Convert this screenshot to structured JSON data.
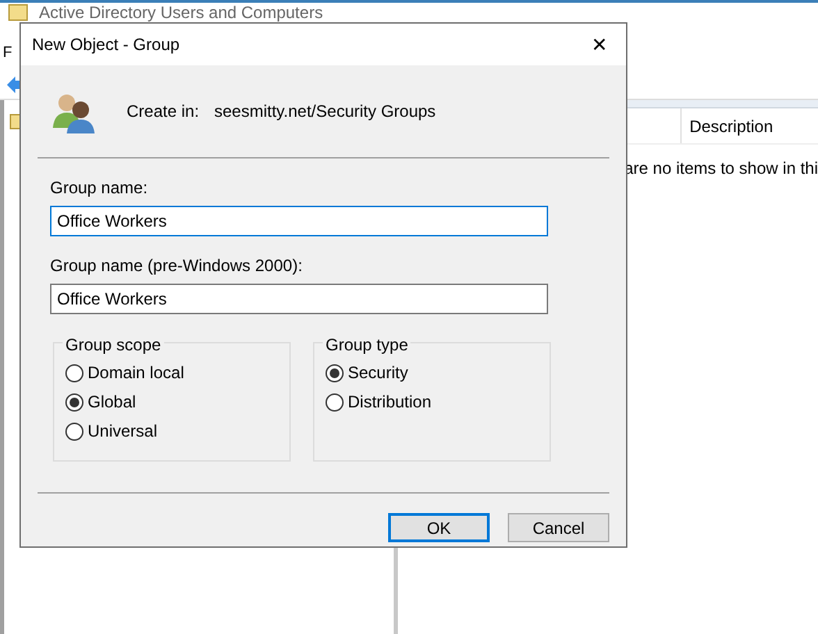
{
  "background_window": {
    "title": "Active Directory Users and Computers",
    "menu_letter": "F",
    "column_header": "Description",
    "empty_message": "are no items to show in thi"
  },
  "dialog": {
    "title": "New Object - Group",
    "close": "✕",
    "create_in_label": "Create in:",
    "create_in_path": "seesmitty.net/Security Groups",
    "fields": [
      {
        "label": "Group name:",
        "value": "Office Workers",
        "focused": true
      },
      {
        "label": "Group name (pre-Windows 2000):",
        "value": "Office Workers",
        "focused": false
      }
    ],
    "groups": [
      {
        "title": "Group scope",
        "options": [
          {
            "label": "Domain local",
            "selected": false
          },
          {
            "label": "Global",
            "selected": true
          },
          {
            "label": "Universal",
            "selected": false
          }
        ]
      },
      {
        "title": "Group type",
        "options": [
          {
            "label": "Security",
            "selected": true
          },
          {
            "label": "Distribution",
            "selected": false
          }
        ]
      }
    ],
    "buttons": [
      {
        "label": "OK",
        "default": true
      },
      {
        "label": "Cancel",
        "default": false
      }
    ]
  }
}
